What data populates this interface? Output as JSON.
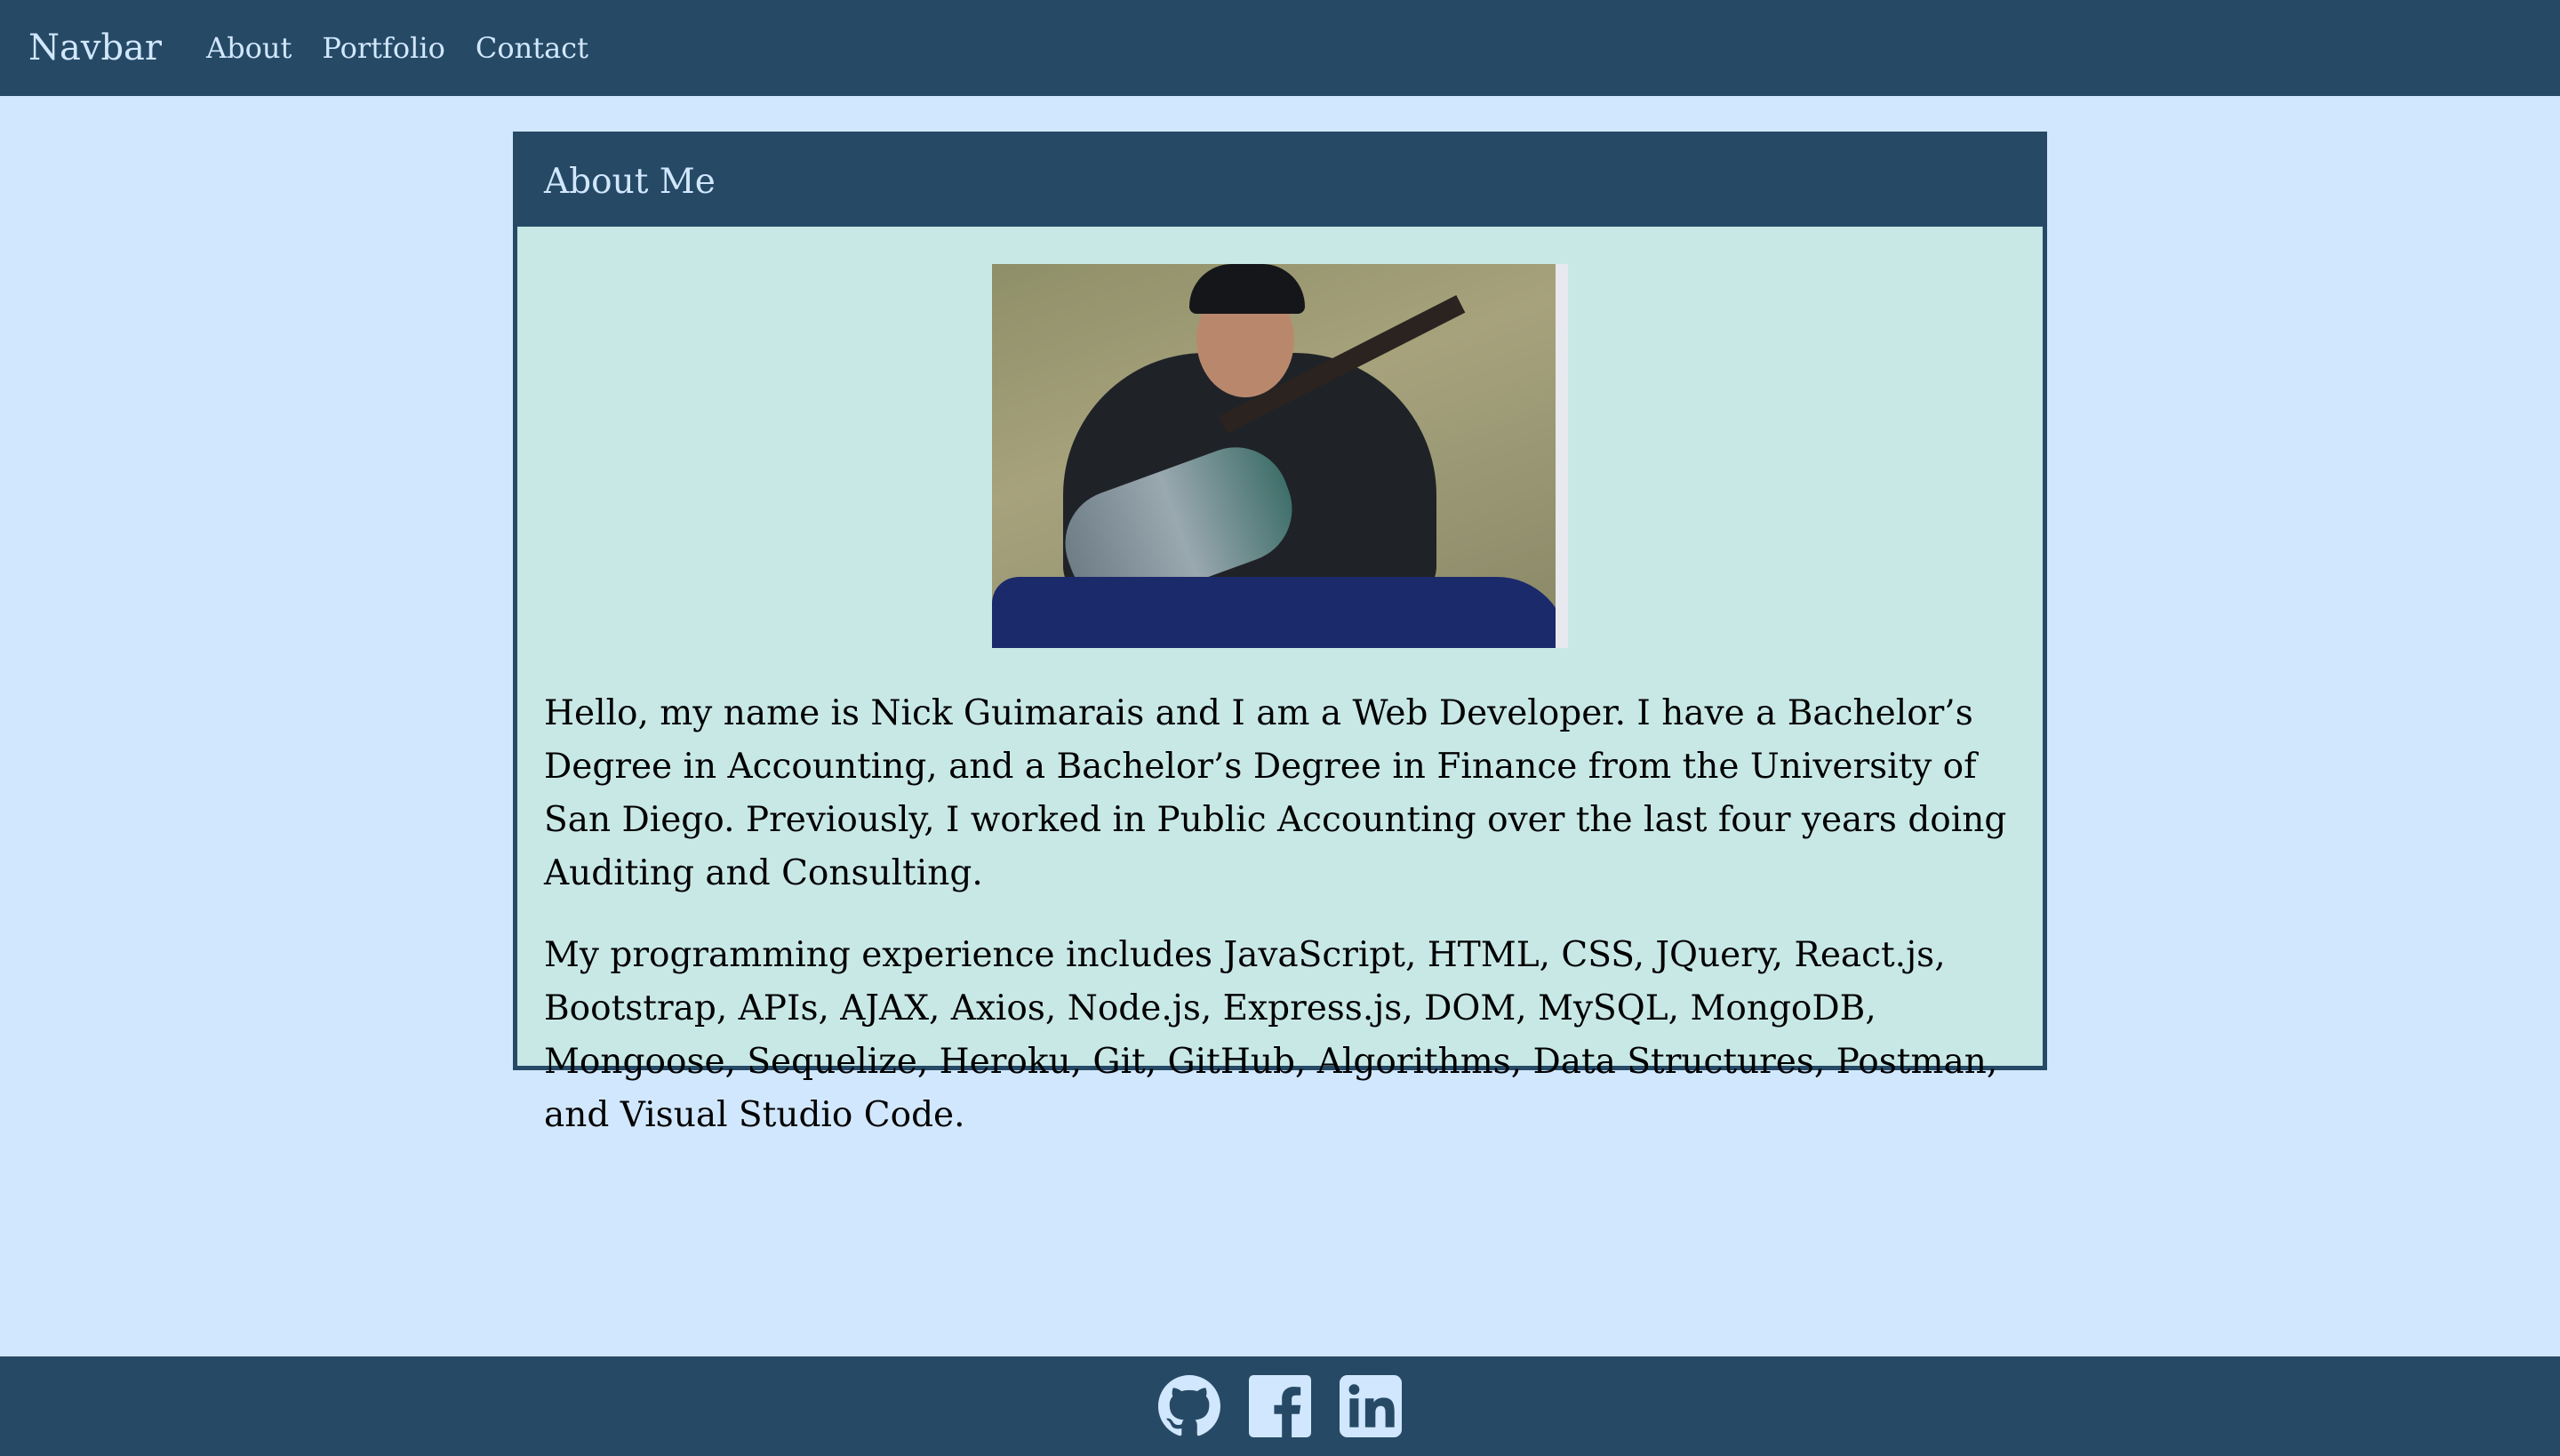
{
  "navbar": {
    "brand": "Navbar",
    "links": [
      "About",
      "Portfolio",
      "Contact"
    ]
  },
  "card": {
    "title": "About Me",
    "photo": "photo-of-person-with-guitar",
    "paragraphs": [
      "Hello, my name is Nick Guimarais and I am a Web Developer. I have a Bachelor’s Degree in Accounting, and a Bachelor’s Degree in Finance from the University of San Diego. Previously, I worked in Public Accounting over the last four years doing Auditing and Consulting.",
      "My programming experience includes JavaScript, HTML, CSS, JQuery, React.js, Bootstrap, APIs, AJAX, Axios, Node.js, Express.js, DOM, MySQL, MongoDB, Mongoose, Sequelize, Heroku, Git, GitHub, Algorithms, Data Structures, Postman, and Visual Studio Code."
    ]
  },
  "footer": {
    "icons": [
      "github-icon",
      "facebook-icon",
      "linkedin-icon"
    ]
  },
  "colors": {
    "page_background": "#d1e7fd",
    "navbar_background": "#264a66",
    "card_background": "#c8e8e6",
    "accent_text": "#d1e7fd"
  }
}
